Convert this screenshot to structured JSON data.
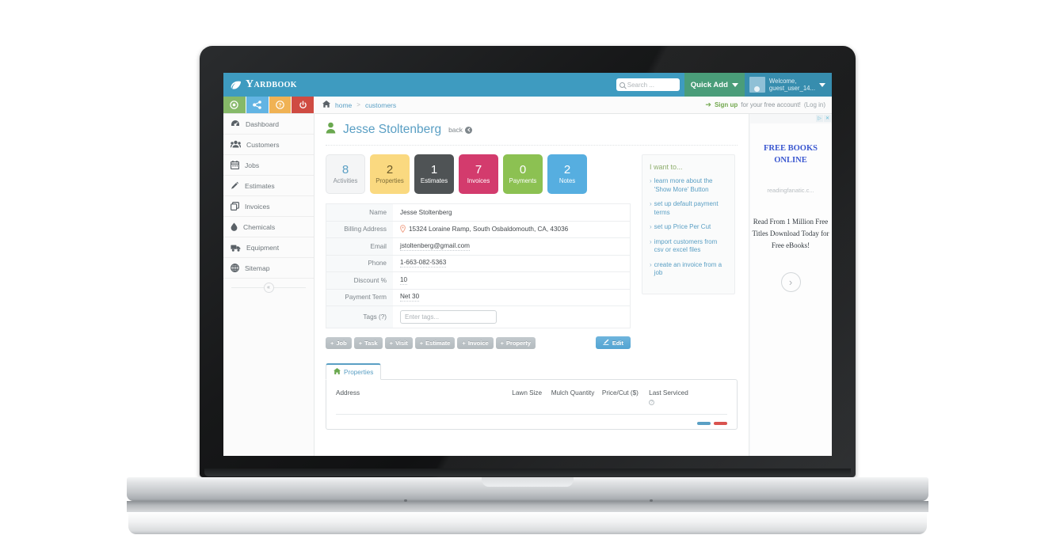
{
  "header": {
    "brand": "Yardbook",
    "brand_icon": "leaf-icon",
    "search_placeholder": "Search ...",
    "search_icon": "search-icon",
    "quick_add": "Quick Add",
    "welcome_line1": "Welcome,",
    "welcome_line2": "guest_user_14...",
    "avatar_icon": "user-avatar-icon"
  },
  "toolbar": {
    "buttons": [
      {
        "name": "record-button",
        "icon": "circle-icon",
        "color": "#86b969"
      },
      {
        "name": "share-button",
        "icon": "share-nodes-icon",
        "color": "#62b4e3"
      },
      {
        "name": "help-button",
        "icon": "question-icon",
        "color": "#f0b254"
      },
      {
        "name": "power-button",
        "icon": "power-icon",
        "color": "#cf4b42"
      }
    ],
    "breadcrumb": {
      "home": "home",
      "separator": ">",
      "current": "customers",
      "home_icon": "home-icon"
    },
    "signup": {
      "arrow": "➔",
      "link": "Sign up",
      "text": "for your free account!",
      "login": "(Log in)"
    }
  },
  "sidebar": {
    "items": [
      {
        "label": "Dashboard",
        "icon": "gauge-icon"
      },
      {
        "label": "Customers",
        "icon": "users-icon"
      },
      {
        "label": "Jobs",
        "icon": "calendar-icon"
      },
      {
        "label": "Estimates",
        "icon": "pencil-icon"
      },
      {
        "label": "Invoices",
        "icon": "copy-icon"
      },
      {
        "label": "Chemicals",
        "icon": "droplet-icon"
      },
      {
        "label": "Equipment",
        "icon": "truck-icon"
      },
      {
        "label": "Sitemap",
        "icon": "globe-icon"
      }
    ],
    "collapse_glyph": "«",
    "collapse_name": "collapse-sidebar-button"
  },
  "page": {
    "title": "Jesse Stoltenberg",
    "title_icon": "person-icon",
    "back_label": "back",
    "back_icon": "back-arrow-icon"
  },
  "stats": [
    {
      "num": "8",
      "label": "Activities",
      "bg": "#f4f5f6",
      "num_color": "#5a9fc4",
      "label_color": "#8a9197"
    },
    {
      "num": "2",
      "label": "Properties",
      "bg": "#fad980",
      "num_color": "#6b5a2a",
      "label_color": "#7d6c38"
    },
    {
      "num": "1",
      "label": "Estimates",
      "bg": "#4f5355",
      "num_color": "#ffffff",
      "label_color": "#ffffff"
    },
    {
      "num": "7",
      "label": "Invoices",
      "bg": "#d33b6d",
      "num_color": "#ffffff",
      "label_color": "#ffffff"
    },
    {
      "num": "0",
      "label": "Payments",
      "bg": "#8cc152",
      "num_color": "#ffffff",
      "label_color": "#ffffff"
    },
    {
      "num": "2",
      "label": "Notes",
      "bg": "#56aee0",
      "num_color": "#ffffff",
      "label_color": "#ffffff"
    }
  ],
  "details": {
    "name_label": "Name",
    "name_value": "Jesse Stoltenberg",
    "billing_label": "Billing Address",
    "billing_value": "15324 Loraine Ramp, South Osbaldomouth, CA, 43036",
    "billing_icon": "map-pin-icon",
    "email_label": "Email",
    "email_value": "jstoltenberg@gmail.com",
    "phone_label": "Phone",
    "phone_value": "1-663-082-5363",
    "discount_label": "Discount %",
    "discount_value": "10",
    "payment_term_label": "Payment Term",
    "payment_term_value": "Net 30",
    "tags_label": "Tags (?)",
    "tags_placeholder": "Enter tags..."
  },
  "actions": {
    "buttons": [
      {
        "label": "Job"
      },
      {
        "label": "Task"
      },
      {
        "label": "Visit"
      },
      {
        "label": "Estimate"
      },
      {
        "label": "Invoice"
      },
      {
        "label": "Property"
      }
    ],
    "plus": "+",
    "edit_label": "Edit",
    "edit_icon": "edit-pencil-icon"
  },
  "iwant": {
    "title": "I want to...",
    "chevron": "›",
    "links": [
      "learn more about the 'Show More' Button",
      "set up default payment terms",
      "set up Price Per Cut",
      "import customers from csv or excel files",
      "create an invoice from a job"
    ]
  },
  "properties_tab": {
    "tab_label": "Properties",
    "tab_icon": "house-icon",
    "columns": [
      "Address",
      "Lawn Size",
      "Mulch Quantity",
      "Price/Cut ($)",
      "Last Serviced"
    ],
    "last_serviced_help_icon": "question-circle-icon",
    "help_glyph": "?"
  },
  "ad": {
    "adchoices_icon": "adchoices-triangle-icon",
    "close_icon": "close-x-icon",
    "adchoices_glyph": "▷",
    "close_glyph": "✕",
    "title_line1": "FREE BOOKS",
    "title_line2": "ONLINE",
    "url": "readingfanatic.c...",
    "copy": "Read From 1 Million Free Titles Download Today for Free eBooks!",
    "next_glyph": "›",
    "next_name": "ad-next-button"
  }
}
